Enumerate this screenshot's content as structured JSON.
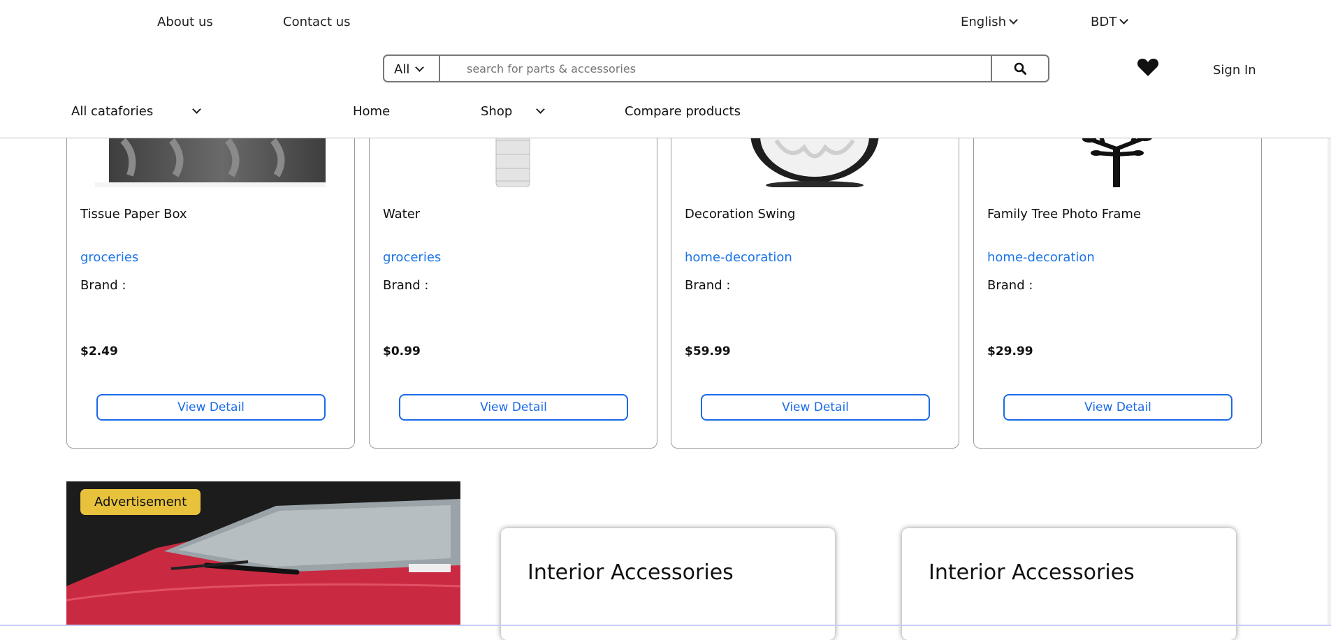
{
  "header": {
    "about": "About us",
    "contact": "Contact us",
    "language": "English",
    "currency": "BDT",
    "search": {
      "scope": "All",
      "placeholder": "search for parts & accessories"
    },
    "signin": "Sign In"
  },
  "nav": {
    "categories": "All catafories",
    "home": "Home",
    "shop": "Shop",
    "compare": "Compare products"
  },
  "products": [
    {
      "title": "Tissue Paper Box",
      "category": "groceries",
      "brand": "Brand :",
      "price": "$2.49",
      "action": "View Detail"
    },
    {
      "title": "Water",
      "category": "groceries",
      "brand": "Brand :",
      "price": "$0.99",
      "action": "View Detail"
    },
    {
      "title": "Decoration Swing",
      "category": "home-decoration",
      "brand": "Brand :",
      "price": "$59.99",
      "action": "View Detail"
    },
    {
      "title": "Family Tree Photo Frame",
      "category": "home-decoration",
      "brand": "Brand :",
      "price": "$29.99",
      "action": "View Detail"
    }
  ],
  "advertisement": {
    "badge": "Advertisement"
  },
  "promos": [
    {
      "title": "Interior Accessories"
    },
    {
      "title": "Interior Accessories"
    }
  ],
  "colors": {
    "link_blue": "#1a73e8",
    "badge_yellow": "#e8c23c",
    "car_red": "#d9304a"
  }
}
